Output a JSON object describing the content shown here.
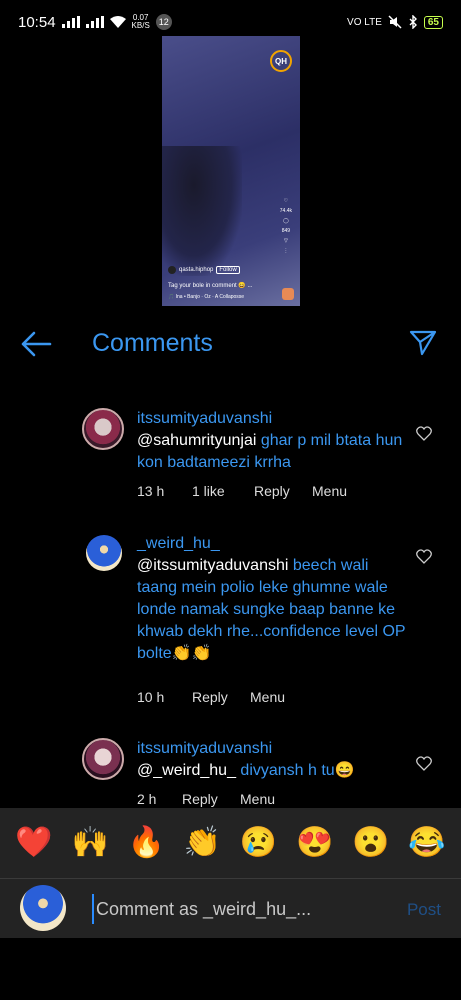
{
  "status_bar": {
    "time": "10:54",
    "net_speed": "0.07",
    "net_unit": "KB/S",
    "notif_count": "12",
    "volte": "VO LTE",
    "battery": "65"
  },
  "preview": {
    "logo": "QH",
    "likes": "74.4k",
    "comments": "849",
    "account": "qasta.hiphop",
    "follow": "Follow",
    "caption": "Tag your bole in comment 😄 ...",
    "music": "🎵 Ina • Banjo · Oz · A Collaposse"
  },
  "header": {
    "title": "Comments"
  },
  "comments": [
    {
      "username": "itssumityaduvanshi",
      "mention": "@sahumrityunjai",
      "text": " ghar p mil btata hun kon badtameezi krrha",
      "time": "13 h",
      "likes": "1 like",
      "reply": "Reply",
      "menu": "Menu"
    },
    {
      "username": "_weird_hu_",
      "mention": "@itssumityaduvanshi",
      "text": " beech wali taang mein polio leke ghumne wale londe namak sungke baap banne ke khwab dekh rhe...confidence level OP bolte👏👏",
      "time": "10 h",
      "reply": "Reply",
      "menu": "Menu"
    },
    {
      "username": "itssumityaduvanshi",
      "mention": "@_weird_hu_",
      "text": " divyansh h tu😄",
      "time": "2 h",
      "reply": "Reply",
      "menu": "Menu"
    }
  ],
  "emoji_bar": [
    "❤️",
    "🙌",
    "🔥",
    "👏",
    "😢",
    "😍",
    "😮",
    "😂"
  ],
  "composer": {
    "placeholder": "Comment as _weird_hu_...",
    "post_label": "Post"
  },
  "colors": {
    "accent": "#3b97f0",
    "background": "#000000",
    "bar": "#232323"
  }
}
